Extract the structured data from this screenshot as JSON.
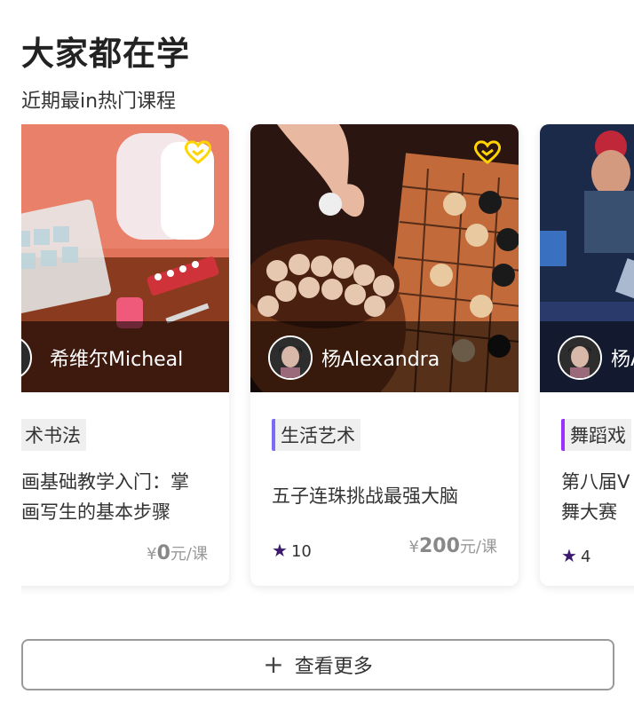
{
  "header": {
    "title": "大家都在学",
    "subtitle": "近期最in热门课程"
  },
  "cards": [
    {
      "author": "希维尔Micheal",
      "tag": "术书法",
      "title_line1": "画基础教学入门：掌",
      "title_line2": "画写生的基本步骤",
      "rating": "",
      "price_symbol": "¥",
      "price_value": "0",
      "price_unit": "元/课",
      "favorite_icon": "heart-outline-icon",
      "accent_color": "#7b6cf6"
    },
    {
      "author": "杨Alexandra",
      "tag": "生活艺术",
      "title_line1": "五子连珠挑战最强大脑",
      "title_line2": "",
      "rating": "10",
      "price_symbol": "¥",
      "price_value": "200",
      "price_unit": "元/课",
      "favorite_icon": "heart-outline-icon",
      "accent_color": "#7b6cf6"
    },
    {
      "author": "杨A",
      "tag": "舞蹈戏",
      "title_line1": "第八届V",
      "title_line2": "舞大赛",
      "rating": "4",
      "price_symbol": "",
      "price_value": "",
      "price_unit": "",
      "favorite_icon": "",
      "accent_color": "#9b30ff"
    }
  ],
  "more_button": {
    "icon": "plus-icon",
    "label": "查看更多"
  },
  "colors": {
    "heart": "#ffd400",
    "star": "#3b1a6e",
    "border": "#9a9a9a"
  }
}
